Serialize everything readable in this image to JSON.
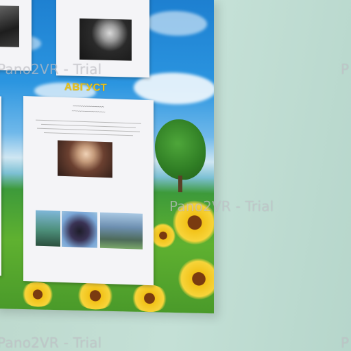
{
  "poster": {
    "month_heading": "АВГУСТ",
    "sheets": {
      "top_middle_caption": "~~~~~~~~~~",
      "main_title": "~~~~~~~~~~~~~~",
      "main_subtitle": "~~~~~~~~~~~~~~~~~~"
    }
  },
  "watermark": {
    "full_text": "Pano2VR - Trial",
    "clipped_text": "P"
  },
  "colors": {
    "wall": "#bcd8cc",
    "sky": "#2b95e0",
    "grass": "#5fb130",
    "month_heading": "#e8c21c",
    "watermark": "#c8c8cd"
  }
}
